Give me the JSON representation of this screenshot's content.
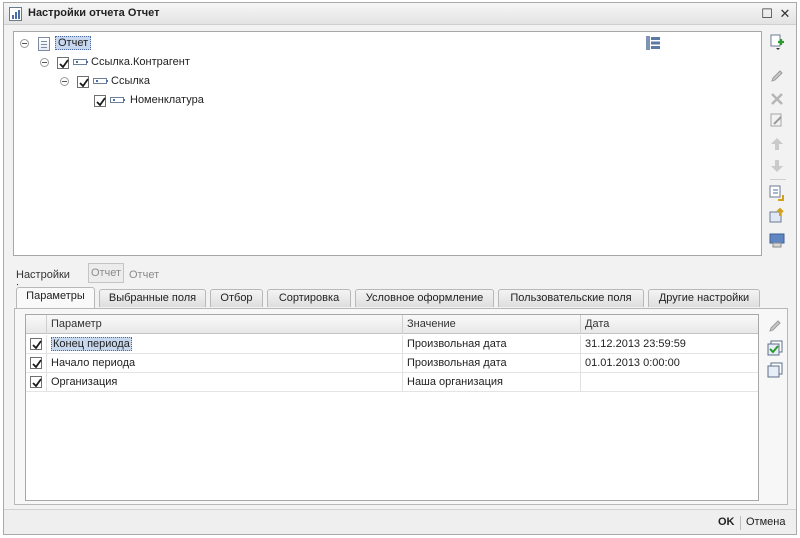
{
  "window": {
    "title": "Настройки отчета  Отчет",
    "maximize_glyph": "☐",
    "close_glyph": "✕"
  },
  "tree": {
    "root": {
      "label": "Отчет",
      "icon": "report-icon",
      "expanded": true
    },
    "nodes": [
      {
        "label": "Ссылка.Контрагент",
        "checked": true,
        "level": 1,
        "expanded": true,
        "icon": "field-icon"
      },
      {
        "label": "Ссылка",
        "checked": true,
        "level": 2,
        "expanded": true,
        "icon": "field-icon"
      },
      {
        "label": "Номенклатура",
        "checked": true,
        "level": 3,
        "icon": "field-icon"
      }
    ]
  },
  "side_toolbar": {
    "buttons": [
      "add-item-icon",
      "edit-pencil-icon",
      "delete-x-icon",
      "properties-icon",
      "move-up-icon",
      "move-down-icon",
      "import-icon",
      "export-icon",
      "save-layout-icon"
    ]
  },
  "settings": {
    "label": "Настройки :",
    "button_label": "Отчет",
    "value": "Отчет"
  },
  "tabs": [
    {
      "label": "Параметры",
      "active": true
    },
    {
      "label": "Выбранные поля",
      "active": false
    },
    {
      "label": "Отбор",
      "active": false
    },
    {
      "label": "Сортировка",
      "active": false
    },
    {
      "label": "Условное оформление",
      "active": false
    },
    {
      "label": "Пользовательские поля",
      "active": false
    },
    {
      "label": "Другие настройки",
      "active": false
    }
  ],
  "grid": {
    "columns": [
      "Параметр",
      "Значение",
      "Дата"
    ],
    "rows": [
      {
        "checked": true,
        "param": "Конец периода",
        "value": "Произвольная дата",
        "date": "31.12.2013 23:59:59"
      },
      {
        "checked": true,
        "param": "Начало периода",
        "value": "Произвольная дата",
        "date": "01.01.2013 0:00:00"
      },
      {
        "checked": true,
        "param": "Организация",
        "value": "Наша организация",
        "date": ""
      }
    ]
  },
  "grid_toolbar": {
    "buttons": [
      "edit-pencil-icon",
      "check-all-icon",
      "uncheck-all-icon"
    ]
  },
  "footer": {
    "ok_label": "OK",
    "cancel_label": "Отмена"
  }
}
